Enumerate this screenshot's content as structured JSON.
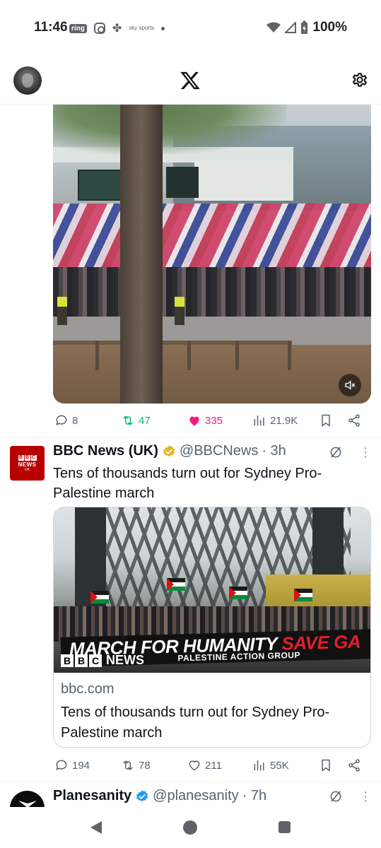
{
  "status_bar": {
    "time": "11:46",
    "ring_label": "ring",
    "sky_label": "sky sports",
    "battery": "100%"
  },
  "header": {
    "logo": "x-logo",
    "settings_icon": "gear-icon"
  },
  "tweet1": {
    "replies": "8",
    "retweets": "47",
    "likes": "335",
    "views": "21.9K"
  },
  "tweet2": {
    "display_name": "BBC News (UK)",
    "handle": "@BBCNews",
    "time": "· 3h",
    "text": "Tens of thousands turn out for Sydney Pro-Palestine march",
    "avatar": {
      "blocks": [
        "B",
        "B",
        "C"
      ],
      "news": "NEWS",
      "uk": "UK"
    },
    "card": {
      "banner_main": "MARCH FOR HUMANITY",
      "banner_red": "SAVE GA",
      "banner_sub": "PALESTINE ACTION GROUP",
      "watermark_blocks": [
        "B",
        "B",
        "C"
      ],
      "watermark_news": "NEWS",
      "domain": "bbc.com",
      "title": "Tens of thousands turn out for Sydney Pro-Palestine march"
    },
    "replies": "194",
    "retweets": "78",
    "likes": "211",
    "views": "55K"
  },
  "tweet3": {
    "display_name": "Planesanity",
    "handle": "@planesanity",
    "time": "· 7h"
  },
  "colors": {
    "retweet_active": "#00ba7c",
    "like_active": "#f91880",
    "verified_gold": "#e2b719",
    "verified_blue": "#1d9bf0",
    "bbc_red": "#b80000"
  }
}
